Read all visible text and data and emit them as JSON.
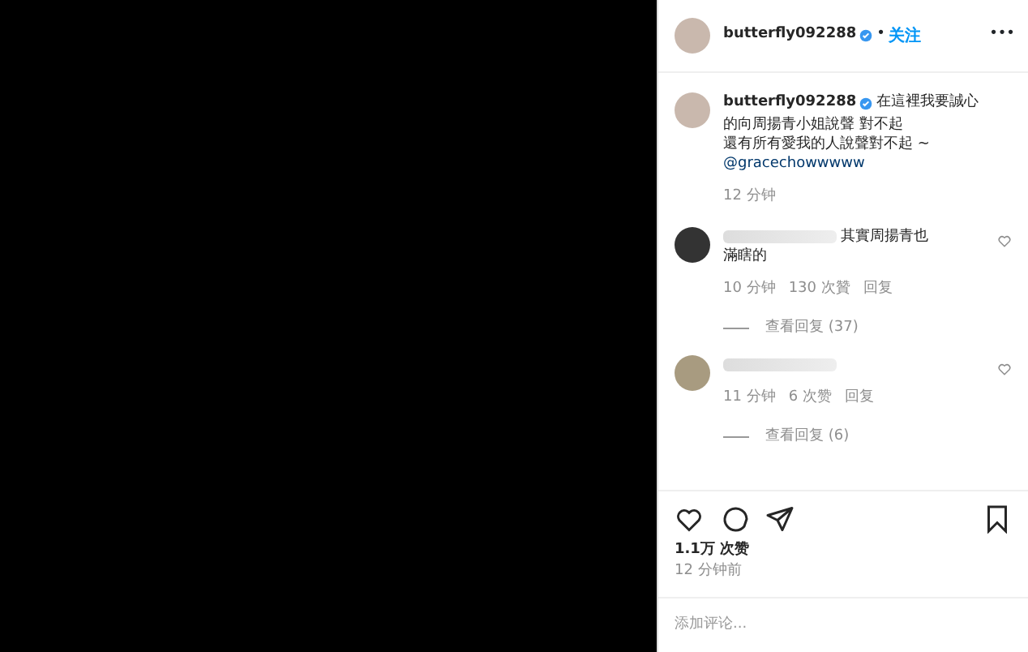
{
  "header": {
    "username": "butterfly092288",
    "verified": true,
    "separator": "•",
    "follow": "关注",
    "more": "•••"
  },
  "caption": {
    "username": "butterfly092288",
    "verified": true,
    "lines": [
      "在這裡我要誠心",
      "的向周揚青小姐說聲 對不起",
      "還有所有愛我的人說聲對不起 ~"
    ],
    "mention": "@gracechowwwww",
    "time": "12 分钟"
  },
  "comments": [
    {
      "lines": [
        "其實周揚青也",
        "滿瞎的"
      ],
      "time": "10 分钟",
      "likes": "130 次贊",
      "reply": "回复",
      "view_replies": "查看回复 (37)",
      "liked": false
    },
    {
      "time": "11 分钟",
      "likes": "6 次赞",
      "reply": "回复",
      "view_replies": "查看回复 (6)",
      "liked": false
    }
  ],
  "likes": "1.1万 次赞",
  "posted": "12 分钟前",
  "add_comment": {
    "placeholder": "添加评论..."
  }
}
